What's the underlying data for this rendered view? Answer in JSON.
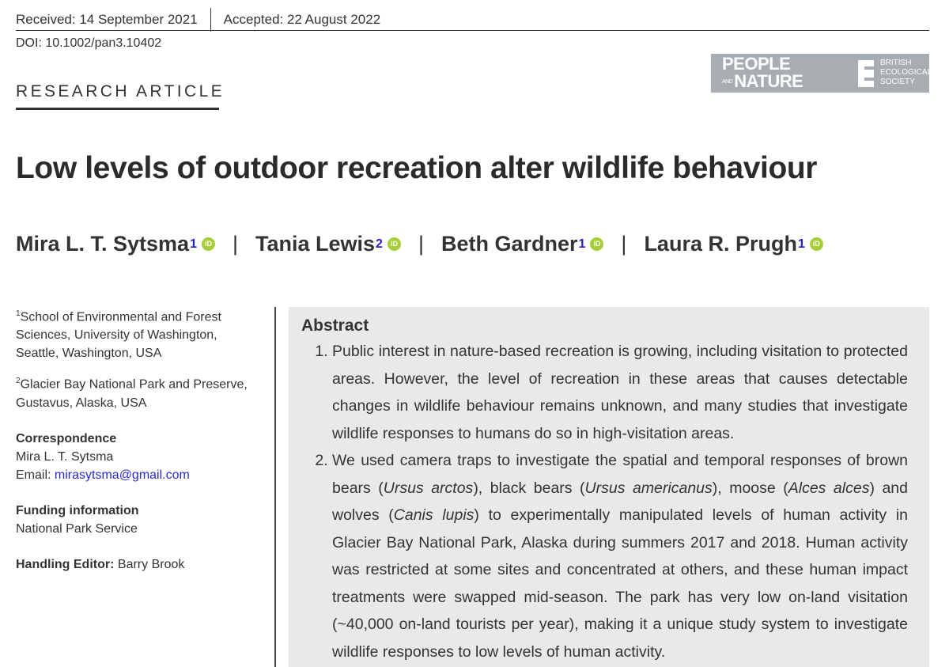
{
  "header": {
    "received": "Received: 14 September 2021",
    "accepted": "Accepted: 22 August 2022",
    "doi": "DOI: 10.1002/pan3.10402"
  },
  "journal_badge": {
    "people": "PEOPLE",
    "and": "AND",
    "nature": "NATURE",
    "society_line1": "BRITISH",
    "society_line2": "ECOLOGICAL",
    "society_line3": "SOCIETY",
    "background_color": "#a7adb1"
  },
  "article_type": "RESEARCH ARTICLE",
  "title": "Low levels of outdoor recreation alter wildlife behaviour",
  "authors": [
    {
      "name": "Mira L. T. Sytsma",
      "affil": "1"
    },
    {
      "name": "Tania Lewis",
      "affil": "2"
    },
    {
      "name": "Beth Gardner",
      "affil": "1"
    },
    {
      "name": "Laura R. Prugh",
      "affil": "1"
    }
  ],
  "orcid_icon_label": "iD",
  "sidebar": {
    "affil1_num": "1",
    "affil1": "School of Environmental and Forest Sciences, University of Washington, Seattle, Washington, USA",
    "affil2_num": "2",
    "affil2": "Glacier Bay National Park and Preserve, Gustavus, Alaska, USA",
    "correspondence_heading": "Correspondence",
    "correspondence_name": "Mira L. T. Sytsma",
    "email_label": "Email: ",
    "email": "mirasytsma@gmail.com",
    "funding_heading": "Funding information",
    "funding": "National Park Service",
    "editor_label": "Handling Editor:",
    "editor": "Barry Brook"
  },
  "abstract": {
    "heading": "Abstract",
    "item1": "Public interest in nature-based recreation is growing, including visitation to protected areas. However, the level of recreation in these areas that causes detectable changes in wildlife behaviour remains unknown, and many studies that investigate wildlife responses to humans do so in high-visitation areas.",
    "item2_a": "We used camera traps to investigate the spatial and temporal responses of brown bears (",
    "item2_sp1": "Ursus arctos",
    "item2_b": "), black bears (",
    "item2_sp2": "Ursus americanus",
    "item2_c": "), moose (",
    "item2_sp3": "Alces alces",
    "item2_d": ") and wolves (",
    "item2_sp4": "Canis lupis",
    "item2_e": ") to experimentally manipulated levels of human activity in Glacier Bay National Park, Alaska during summers 2017 and 2018. Human activity was restricted at some sites and concentrated at others, and these human impact treatments were swapped mid-season. The park has very low on-land visitation (~40,000 on-land tourists per year), making it a unique study system to investigate wildlife responses to low levels of human activity."
  }
}
